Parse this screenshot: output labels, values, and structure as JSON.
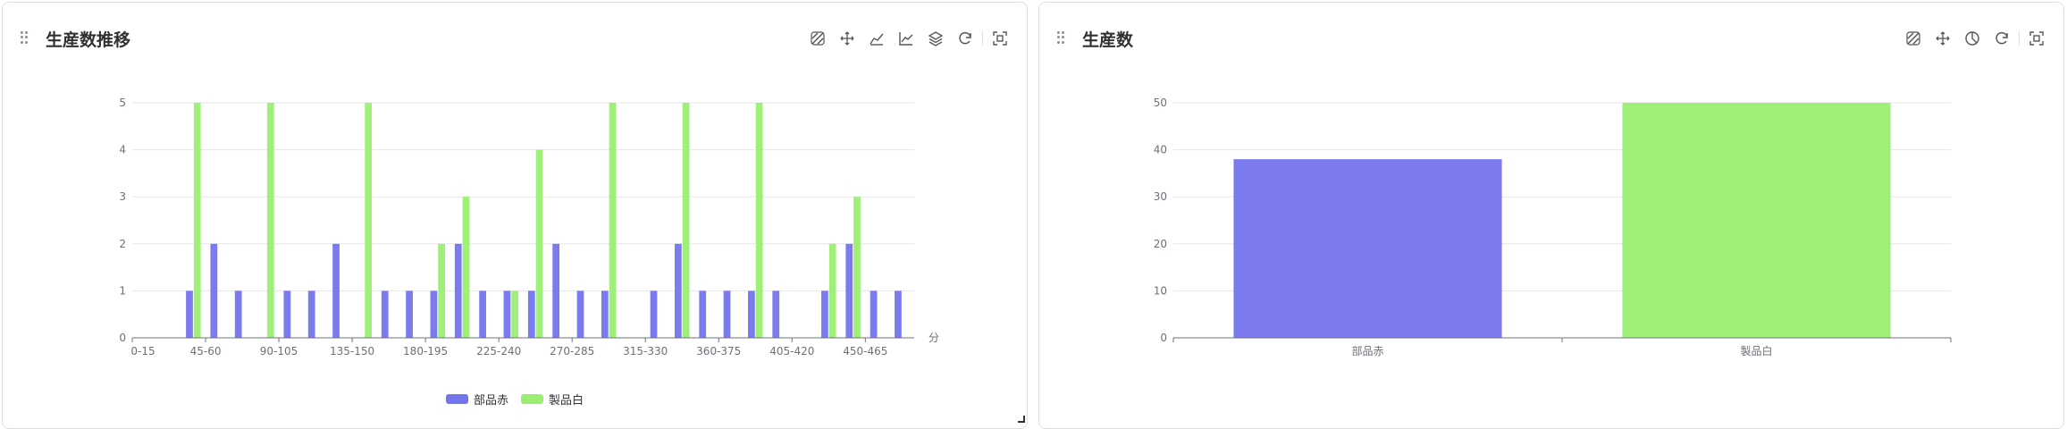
{
  "colors": {
    "series_a": "#7474ee",
    "series_b": "#9aee72",
    "grid": "#e6e6e6",
    "axis": "#6e7079",
    "text": "#6e7079"
  },
  "panels": {
    "left": {
      "title": "生産数推移"
    },
    "right": {
      "title": "生産数"
    }
  },
  "toolbar_left": [
    "data-zoom-icon",
    "pan-move-icon",
    "area-chart-icon",
    "line-chart-icon",
    "layers-icon",
    "refresh-icon",
    "screenshot-icon"
  ],
  "toolbar_right": [
    "data-zoom-icon",
    "pan-move-icon",
    "pie-chart-icon",
    "refresh-icon",
    "screenshot-icon"
  ],
  "legend": {
    "series_a": "部品赤",
    "series_b": "製品白"
  },
  "chart_data": [
    {
      "type": "bar",
      "title": "生産数推移",
      "xlabel": "分",
      "ylabel": "",
      "ylim": [
        0,
        5
      ],
      "yticks": [
        0,
        1,
        2,
        3,
        4,
        5
      ],
      "categories": [
        "0-15",
        "15-30",
        "30-45",
        "45-60",
        "60-75",
        "75-90",
        "90-105",
        "105-120",
        "120-135",
        "135-150",
        "150-165",
        "165-180",
        "180-195",
        "195-210",
        "210-225",
        "225-240",
        "240-255",
        "255-270",
        "270-285",
        "285-300",
        "300-315",
        "315-330",
        "330-345",
        "345-360",
        "360-375",
        "375-390",
        "390-405",
        "405-420",
        "420-435",
        "435-450",
        "450-465",
        "465-480"
      ],
      "tick_labels": [
        "0-15",
        "45-60",
        "90-105",
        "135-150",
        "180-195",
        "225-240",
        "270-285",
        "315-330",
        "360-375",
        "405-420",
        "450-465"
      ],
      "tick_every": 3,
      "series": [
        {
          "name": "部品赤",
          "values": [
            0,
            0,
            1,
            2,
            1,
            0,
            1,
            1,
            2,
            0,
            1,
            1,
            1,
            2,
            1,
            1,
            1,
            2,
            1,
            1,
            0,
            1,
            2,
            1,
            1,
            1,
            1,
            0,
            1,
            2,
            1,
            1
          ]
        },
        {
          "name": "製品白",
          "values": [
            0,
            0,
            5,
            0,
            0,
            5,
            0,
            0,
            0,
            5,
            0,
            0,
            2,
            3,
            0,
            1,
            4,
            0,
            0,
            5,
            0,
            0,
            5,
            0,
            0,
            5,
            0,
            0,
            2,
            3,
            0,
            0
          ]
        }
      ],
      "legend_position": "bottom-center"
    },
    {
      "type": "bar",
      "title": "生産数",
      "xlabel": "",
      "ylabel": "",
      "ylim": [
        0,
        50
      ],
      "yticks": [
        0,
        10,
        20,
        30,
        40,
        50
      ],
      "categories": [
        "部品赤",
        "製品白"
      ],
      "values": [
        38,
        50
      ]
    }
  ]
}
